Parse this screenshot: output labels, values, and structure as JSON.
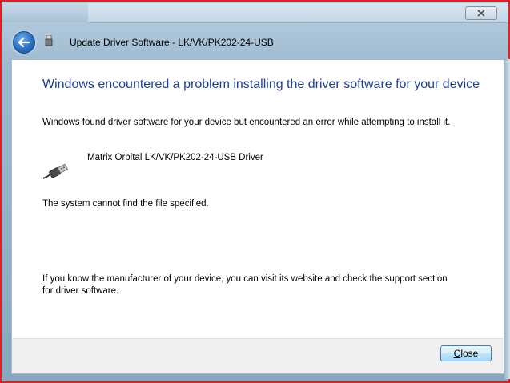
{
  "background": {
    "window_close_icon": "close-icon"
  },
  "dialog": {
    "title": "Update Driver Software - LK/VK/PK202-24-USB",
    "back_icon": "back-arrow-icon",
    "heading": "Windows encountered a problem installing the driver software for your device",
    "message": "Windows found driver software for your device but encountered an error while attempting to install it.",
    "driver_name": "Matrix Orbital LK/VK/PK202-24-USB Driver",
    "device_icon": "usb-cable-icon",
    "error": "The system cannot find the file specified.",
    "advice": "If you know the manufacturer of your device, you can visit its website and check the support section for driver software.",
    "close_button": {
      "accel": "C",
      "rest": "lose"
    }
  },
  "colors": {
    "heading": "#1e3f9a",
    "accent_border": "#e3201b",
    "button_border": "#3c7fb1"
  }
}
